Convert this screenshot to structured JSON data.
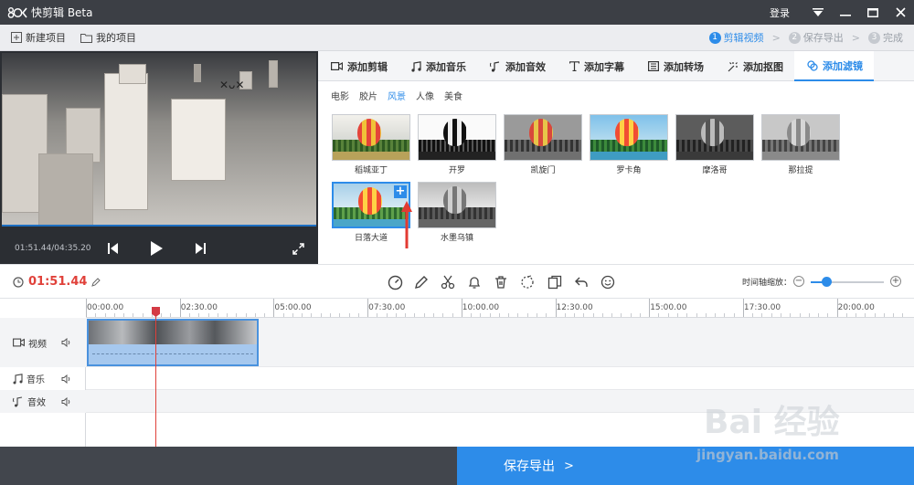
{
  "titlebar": {
    "logo_text": "80<",
    "app_name": "快剪辑 Beta",
    "login": "登录",
    "icons": [
      "dropdown-icon",
      "minimize-icon",
      "maximize-icon",
      "close-icon"
    ]
  },
  "projbar": {
    "new_project": "新建项目",
    "my_projects": "我的项目",
    "steps": [
      {
        "num": "1",
        "label": "剪辑视频",
        "active": true
      },
      {
        "num": "2",
        "label": "保存导出",
        "active": false
      },
      {
        "num": "3",
        "label": "完成",
        "active": false
      }
    ],
    "step_sep": ">"
  },
  "preview": {
    "time": "01:51.44/04:35.20",
    "icons": [
      "prev-icon",
      "play-icon",
      "next-icon",
      "fullscreen-icon"
    ]
  },
  "tabs": [
    {
      "label": "添加剪辑",
      "icon": "video-clip-icon",
      "active": false
    },
    {
      "label": "添加音乐",
      "icon": "music-icon",
      "active": false
    },
    {
      "label": "添加音效",
      "icon": "sound-effect-icon",
      "active": false
    },
    {
      "label": "添加字幕",
      "icon": "text-icon",
      "active": false
    },
    {
      "label": "添加转场",
      "icon": "transition-icon",
      "active": false
    },
    {
      "label": "添加抠图",
      "icon": "cutout-icon",
      "active": false
    },
    {
      "label": "添加滤镜",
      "icon": "filter-icon",
      "active": true
    }
  ],
  "filter_categories": [
    {
      "label": "电影",
      "active": false
    },
    {
      "label": "胶片",
      "active": false
    },
    {
      "label": "风景",
      "active": true
    },
    {
      "label": "人像",
      "active": false
    },
    {
      "label": "美食",
      "active": false
    }
  ],
  "filters": [
    {
      "label": "稻城亚丁",
      "style": "color"
    },
    {
      "label": "开罗",
      "style": "bw"
    },
    {
      "label": "凯旋门",
      "style": "gray"
    },
    {
      "label": "罗卡角",
      "style": "vivid"
    },
    {
      "label": "摩洛哥",
      "style": "gray"
    },
    {
      "label": "那拉提",
      "style": "mute"
    },
    {
      "label": "日落大道",
      "style": "sunset",
      "selected": true,
      "badge": "+"
    },
    {
      "label": "水墨乌镇",
      "style": "ink"
    }
  ],
  "edit_toolbar": {
    "current_time": "01:51.44",
    "tools": [
      "speed-icon",
      "edit-pen-icon",
      "cut-icon",
      "bell-icon",
      "delete-icon",
      "crop-icon",
      "copy-icon",
      "undo-icon",
      "sticker-icon"
    ],
    "zoom_label": "时间轴缩放：",
    "zoom_minus": "−",
    "zoom_plus": "+",
    "zoom_level": 0.2
  },
  "timeline": {
    "ruler_labels": [
      "00:00.00",
      "02:30.00",
      "05:00.00",
      "07:30.00",
      "10:00.00",
      "12:30.00",
      "15:00.00",
      "17:30.00",
      "20:00.00"
    ],
    "tracks": [
      {
        "label": "视频",
        "icon": "video-track-icon"
      },
      {
        "label": "音乐",
        "icon": "music-track-icon"
      },
      {
        "label": "音效",
        "icon": "sound-track-icon"
      }
    ]
  },
  "bottom": {
    "save_export": "保存导出",
    "arrow": ">"
  },
  "watermark": {
    "text": "Bai 经验",
    "url": "jingyan.baidu.com"
  },
  "colors": {
    "accent": "#2d8ce9",
    "time_red": "#e0413a",
    "titlebar": "#3c3f45"
  }
}
